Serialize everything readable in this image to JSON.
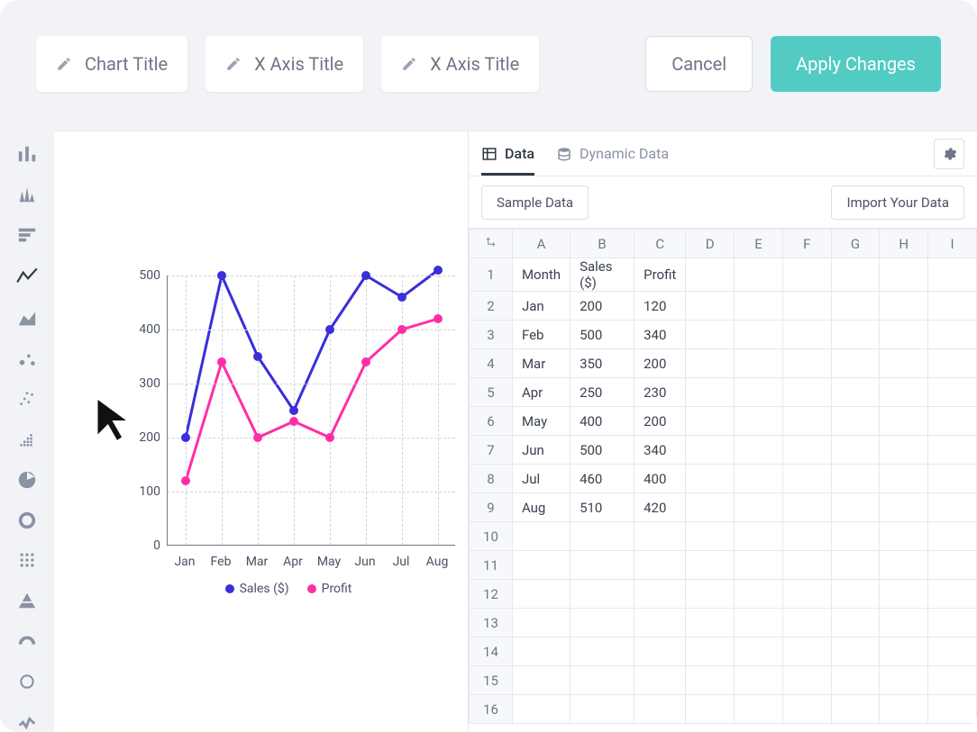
{
  "toolbar": {
    "chart_title_placeholder": "Chart Title",
    "x_axis_placeholder": "X Axis Title",
    "y_axis_placeholder": "X Axis Title",
    "cancel_label": "Cancel",
    "apply_label": "Apply Changes"
  },
  "data_panel": {
    "tab_data": "Data",
    "tab_dynamic": "Dynamic Data",
    "sample_btn": "Sample Data",
    "import_btn": "Import Your Data",
    "columns": [
      "A",
      "B",
      "C",
      "D",
      "E",
      "F",
      "G",
      "H",
      "I"
    ],
    "total_rows": 16,
    "rows": [
      [
        "Month",
        "Sales ($)",
        "Profit"
      ],
      [
        "Jan",
        "200",
        "120"
      ],
      [
        "Feb",
        "500",
        "340"
      ],
      [
        "Mar",
        "350",
        "200"
      ],
      [
        "Apr",
        "250",
        "230"
      ],
      [
        "May",
        "400",
        "200"
      ],
      [
        "Jun",
        "500",
        "340"
      ],
      [
        "Jul",
        "460",
        "400"
      ],
      [
        "Aug",
        "510",
        "420"
      ]
    ]
  },
  "chart_data": {
    "type": "line",
    "categories": [
      "Jan",
      "Feb",
      "Mar",
      "Apr",
      "May",
      "Jun",
      "Jul",
      "Aug"
    ],
    "series": [
      {
        "name": "Sales ($)",
        "values": [
          200,
          500,
          350,
          250,
          400,
          500,
          460,
          510
        ],
        "color": "#3a2fd8"
      },
      {
        "name": "Profit",
        "values": [
          120,
          340,
          200,
          230,
          200,
          340,
          400,
          420
        ],
        "color": "#ff2ea6"
      }
    ],
    "ylim": [
      0,
      500
    ],
    "yticks": [
      0,
      100,
      200,
      300,
      400,
      500
    ],
    "xlabel": "",
    "ylabel": ""
  }
}
